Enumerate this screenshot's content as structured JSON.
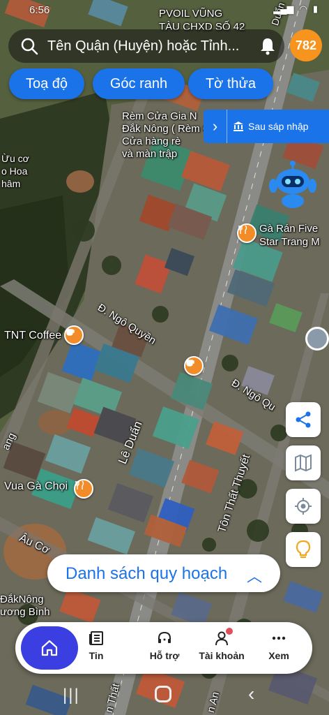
{
  "status_bar": {
    "time": "6:56",
    "icons": [
      "signal-icon",
      "wifi-icon",
      "battery-icon"
    ]
  },
  "search": {
    "placeholder": "Tên Quận (Huyện) hoặc Tỉnh..."
  },
  "notification": {
    "icon": "bell-icon"
  },
  "score_badge": {
    "value": "782"
  },
  "chips": [
    {
      "label": "Toạ độ"
    },
    {
      "label": "Góc ranh"
    },
    {
      "label": "Tờ thửa"
    }
  ],
  "merge_panel": {
    "label": "Sau sáp nhập",
    "icon": "bank-icon"
  },
  "map_labels": {
    "top_sign": "PVOIL VŨNG\nTÀU CHXD SỐ 42",
    "street_top_right": "Duẩn",
    "curtain_shop": "Rèm Cửa Gia N\nĐắk Nông ( Rèm C\nCửa hàng rè\nvà màn trập",
    "left_text": "Ừu cơ\no Hoa\nhâm",
    "fried_chicken": "Gà Rán Five\nStar Trang M",
    "ngo_quyen_1": "Đ. Ngô Quyền",
    "tnt_coffee": "TNT Coffee",
    "ngo_quyen_2": "Đ. Ngô Qu",
    "le_duan": "Lê Duẩn",
    "ton_that_thuyet": "Tôn Thất Thuyết",
    "vua_ga_choi": "Vua Gà Chọi",
    "au_co": "Âu Cơ",
    "left_edge": "ang",
    "dak_nong": "ĐắkNông\nương Bình",
    "bottom_1": "n Thất",
    "bottom_2": "n An"
  },
  "floating_buttons": [
    "share-icon",
    "map-icon",
    "my-location-icon",
    "lightbulb-icon"
  ],
  "planning_list": {
    "label": "Danh sách quy hoạch"
  },
  "bottom_nav": {
    "items": [
      {
        "label": "",
        "icon": "home-icon"
      },
      {
        "label": "Tin",
        "icon": "news-icon"
      },
      {
        "label": "Hỗ trợ",
        "icon": "support-icon"
      },
      {
        "label": "Tài khoản",
        "icon": "account-icon"
      },
      {
        "label": "Xem",
        "icon": "more-icon"
      }
    ]
  },
  "colors": {
    "accent": "#1a73e8",
    "badge": "#f7941d",
    "home": "#3b3ee0",
    "poi": "#f28c28"
  }
}
